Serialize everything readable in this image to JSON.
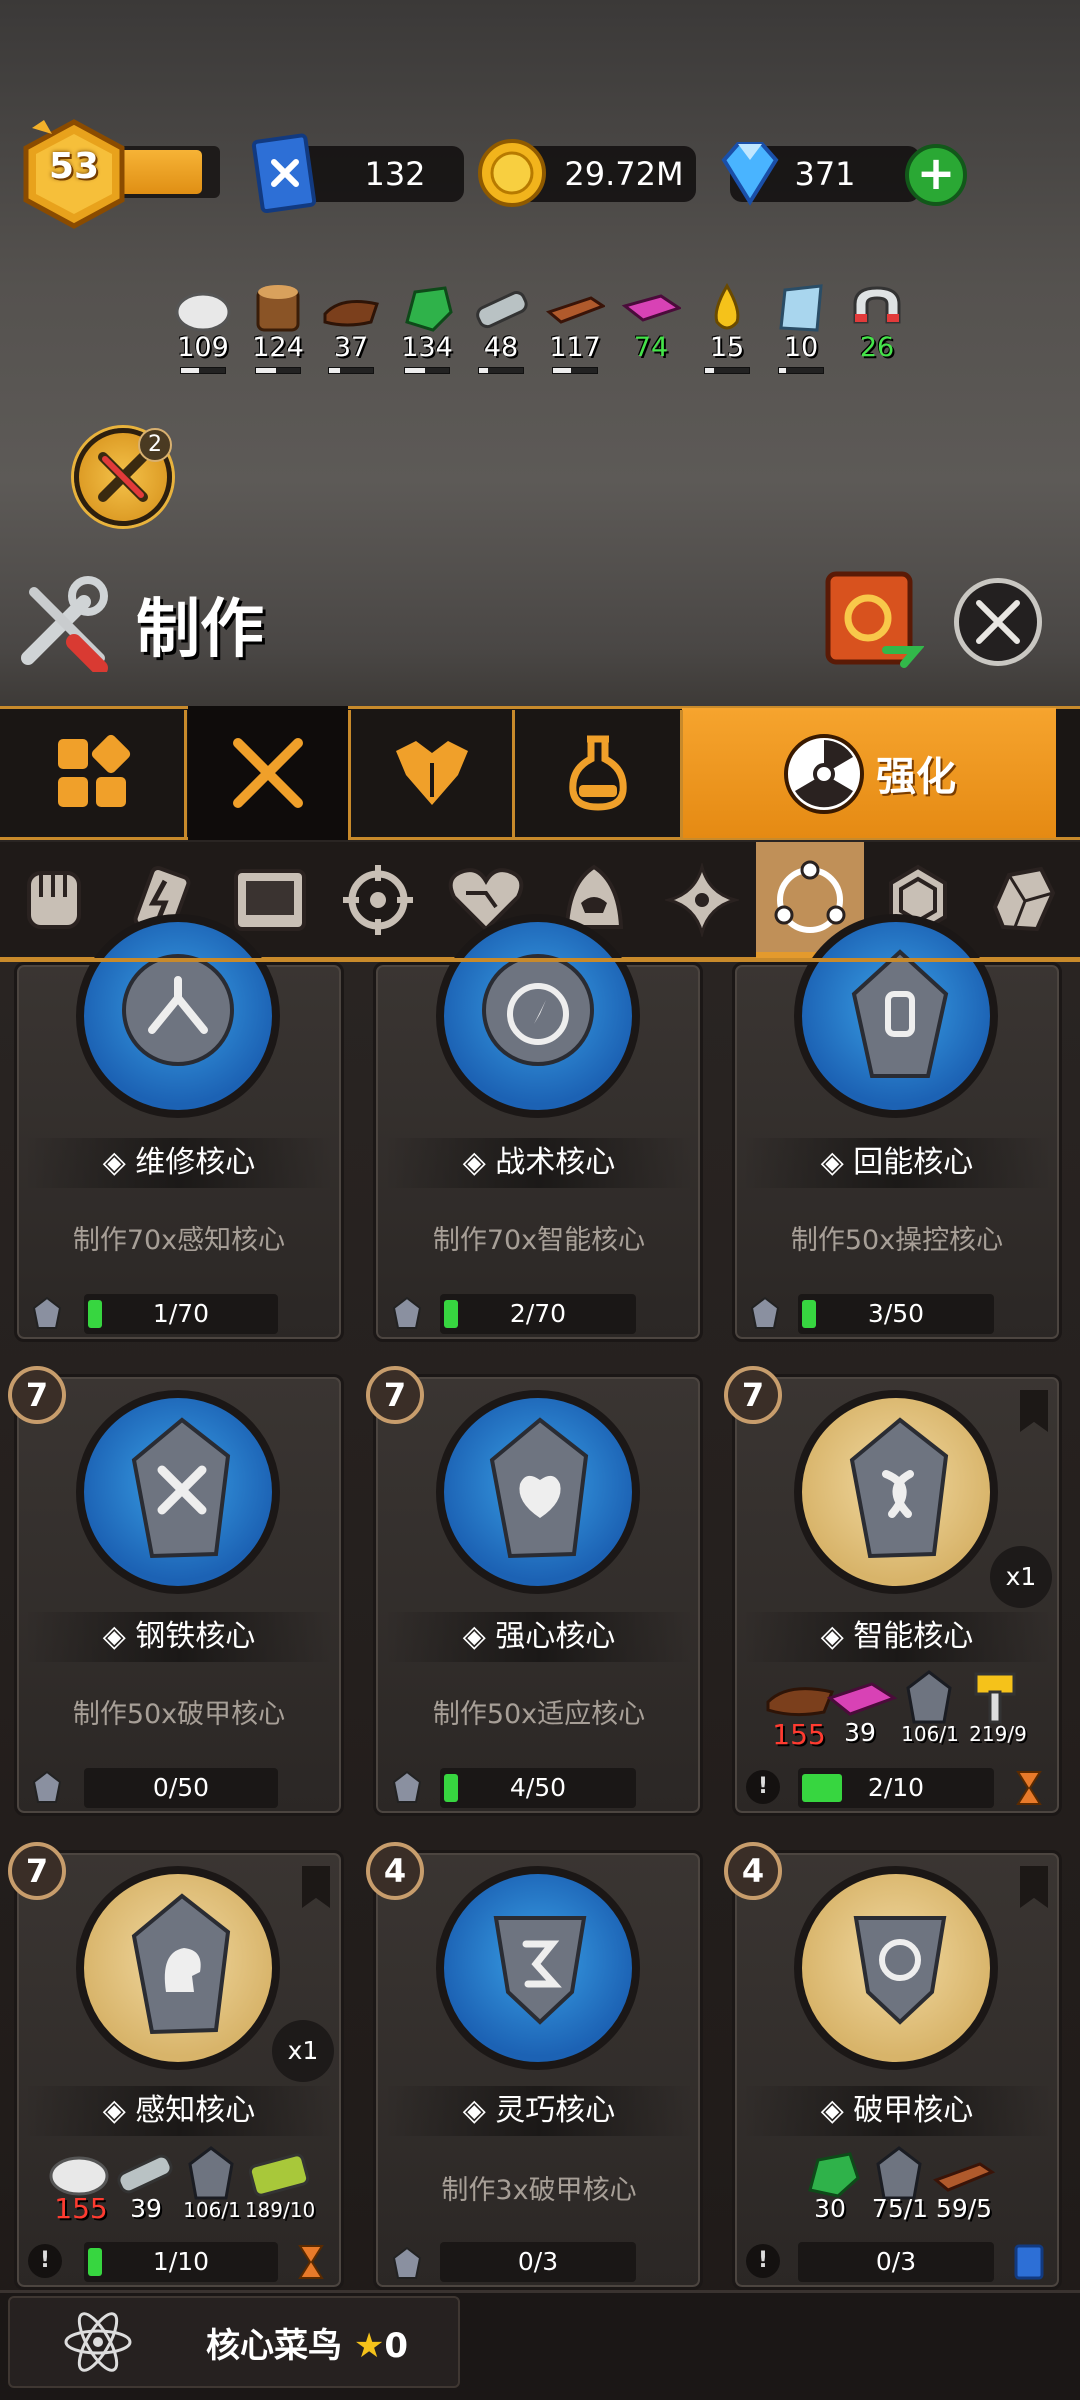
{
  "player": {
    "level": "53"
  },
  "currencies": {
    "blueprint": "132",
    "gold": "29.72M",
    "gems": "371"
  },
  "materials": [
    {
      "name": "wool-icon",
      "value": "109",
      "color": "#ffffff"
    },
    {
      "name": "wood-log-icon",
      "value": "124",
      "color": "#ffffff"
    },
    {
      "name": "leather-icon",
      "value": "37",
      "color": "#ffffff"
    },
    {
      "name": "green-crystal-icon",
      "value": "134",
      "color": "#ffffff"
    },
    {
      "name": "steel-pipe-icon",
      "value": "48",
      "color": "#ffffff"
    },
    {
      "name": "copper-bar-icon",
      "value": "117",
      "color": "#ffffff"
    },
    {
      "name": "pink-cloth-icon",
      "value": "74",
      "color": "#45e34a"
    },
    {
      "name": "oil-drop-icon",
      "value": "15",
      "color": "#ffffff"
    },
    {
      "name": "glass-icon",
      "value": "10",
      "color": "#ffffff"
    },
    {
      "name": "magnet-icon",
      "value": "26",
      "color": "#45e34a"
    }
  ],
  "craft_badge_count": "2",
  "title": "制作",
  "tabs": {
    "active_label": "强化"
  },
  "cards": [
    {
      "name": "维修核心",
      "desc": "制作70x感知核心",
      "progress": "1/70"
    },
    {
      "name": "战术核心",
      "desc": "制作70x智能核心",
      "progress": "2/70"
    },
    {
      "name": "回能核心",
      "desc": "制作50x操控核心",
      "progress": "3/50"
    },
    {
      "level": "7",
      "name": "钢铁核心",
      "desc": "制作50x破甲核心",
      "progress": "0/50"
    },
    {
      "level": "7",
      "name": "强心核心",
      "desc": "制作50x适应核心",
      "progress": "4/50"
    },
    {
      "level": "7",
      "name": "智能核心",
      "count": "x1",
      "progress": "2/10",
      "ingredients": [
        "155",
        "39",
        "106/1",
        "219/9"
      ]
    },
    {
      "level": "7",
      "name": "感知核心",
      "count": "x1",
      "progress": "1/10",
      "ingredients": [
        "155",
        "39",
        "106/1",
        "189/10"
      ]
    },
    {
      "level": "4",
      "name": "灵巧核心",
      "desc": "制作3x破甲核心",
      "progress": "0/3"
    },
    {
      "level": "4",
      "name": "破甲核心",
      "progress": "0/3",
      "ingredients": [
        "30",
        "75/1",
        "59/5"
      ]
    }
  ],
  "footer": {
    "rank_label": "核心菜鸟",
    "stars": "0"
  },
  "colors": {
    "accent": "#f0a02a",
    "tab_border": "#c88a2b",
    "progress_green": "#37d640",
    "low_red": "#ff3b30"
  }
}
